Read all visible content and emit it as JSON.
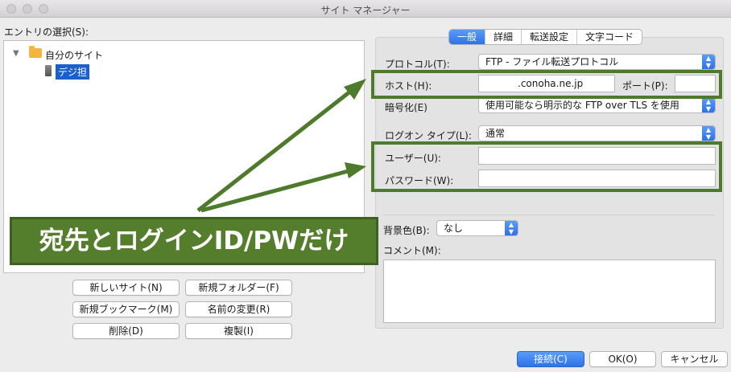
{
  "window": {
    "title": "サイト マネージャー"
  },
  "left": {
    "entry_label": "エントリの選択(S):",
    "tree": {
      "folder": "自分のサイト",
      "site": "デジ担"
    },
    "buttons": {
      "new_site": "新しいサイト(N)",
      "new_folder": "新規フォルダー(F)",
      "new_bookmark": "新規ブックマーク(M)",
      "rename": "名前の変更(R)",
      "delete": "削除(D)",
      "duplicate": "複製(I)"
    }
  },
  "tabs": [
    {
      "label": "一般",
      "active": true
    },
    {
      "label": "詳細",
      "active": false
    },
    {
      "label": "転送設定",
      "active": false
    },
    {
      "label": "文字コード",
      "active": false
    }
  ],
  "general": {
    "protocol_label": "プロトコル(T):",
    "protocol_value": "FTP - ファイル転送プロトコル",
    "host_label": "ホスト(H):",
    "host_value": ".conoha.ne.jp",
    "port_label": "ポート(P):",
    "port_value": "",
    "encryption_label": "暗号化(E)",
    "encryption_value": "使用可能なら明示的な FTP over TLS を使用",
    "logon_type_label": "ログオン タイプ(L):",
    "logon_type_value": "通常",
    "user_label": "ユーザー(U):",
    "user_value": "",
    "password_label": "パスワード(W):",
    "password_value": "",
    "bgcolor_label": "背景色(B):",
    "bgcolor_value": "なし",
    "comment_label": "コメント(M):",
    "comment_value": ""
  },
  "annotation": {
    "text": "宛先とログインID/PWだけ",
    "color": "#547d2c"
  },
  "footer": {
    "connect": "接続(C)",
    "ok": "OK(O)",
    "cancel": "キャンセル"
  }
}
